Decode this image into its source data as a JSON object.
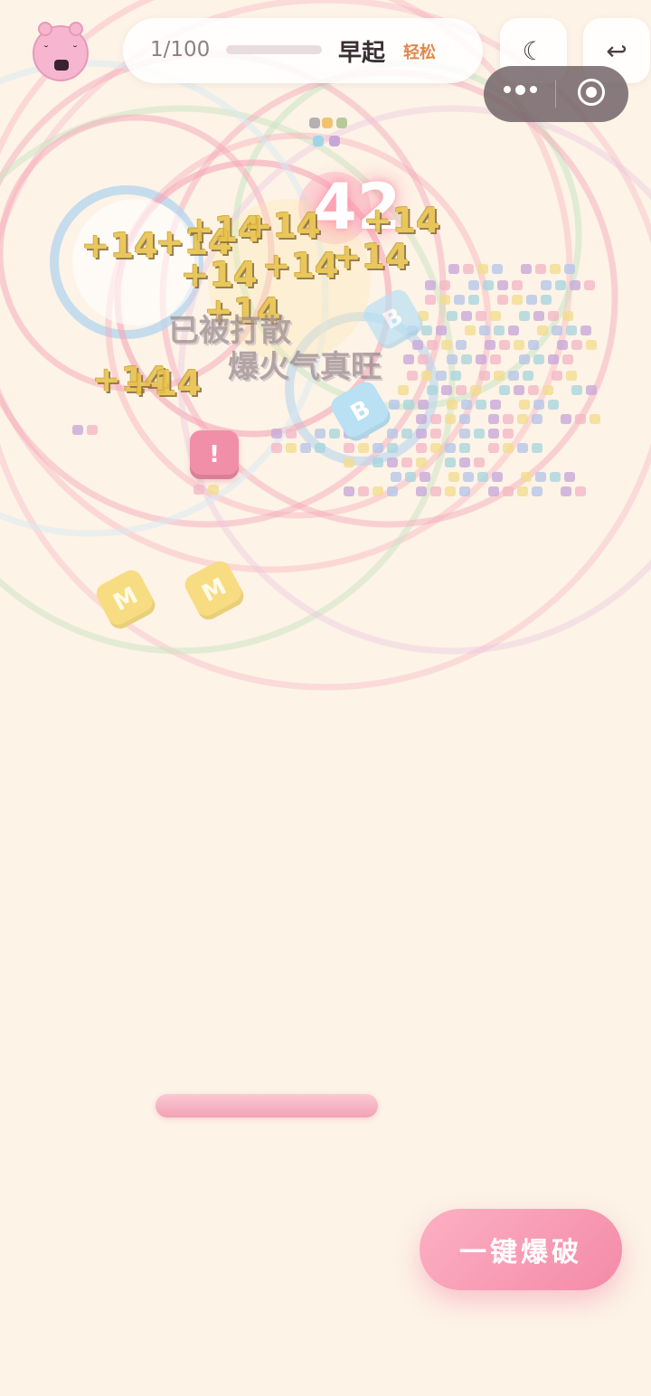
{
  "header": {
    "level_progress": "1/100",
    "level_name": "早起",
    "difficulty": "轻松",
    "night_mode_icon": "☾",
    "back_icon": "↩"
  },
  "game": {
    "score": "42",
    "float_text": "+14",
    "message_line1": "已被打散",
    "message_line2": "爆火气真旺",
    "block_pink_label": "!",
    "block_yellow_label": "M",
    "block_blue_label": "B"
  },
  "actions": {
    "blast_label": "一键爆破"
  },
  "colors": {
    "background": "#fdf3e7",
    "accent_pink": "#f48aa9",
    "difficulty": "#e0874a"
  }
}
